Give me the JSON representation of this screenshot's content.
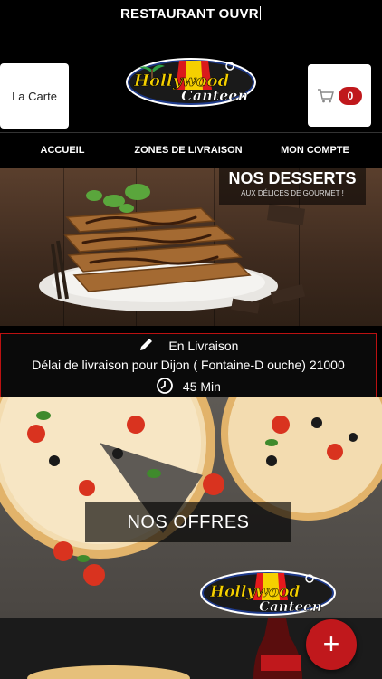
{
  "status_bar": {
    "text": "RESTAURANT OUVR"
  },
  "header": {
    "carte_label": "La Carte",
    "logo_top": "Hollywood",
    "logo_bottom": "Canteen",
    "cart_count": "0"
  },
  "nav": {
    "items": [
      {
        "label": "ACCUEIL"
      },
      {
        "label": "ZONES DE LIVRAISON"
      },
      {
        "label": "MON COMPTE"
      }
    ]
  },
  "desserts_banner": {
    "title": "NOS DESSERTS",
    "subtitle": "AUX DÉLICES DE GOURMET !"
  },
  "delivery": {
    "mode": "En Livraison",
    "description": "Délai de livraison pour Dijon ( Fontaine-D ouche) 21000",
    "time": "45 Min"
  },
  "offres_banner": {
    "title": "NOS OFFRES",
    "logo_top": "Hollywood",
    "logo_bottom": "Canteen"
  },
  "fab": {
    "label": "+"
  },
  "colors": {
    "accent": "#c0181c",
    "background": "#000000"
  }
}
